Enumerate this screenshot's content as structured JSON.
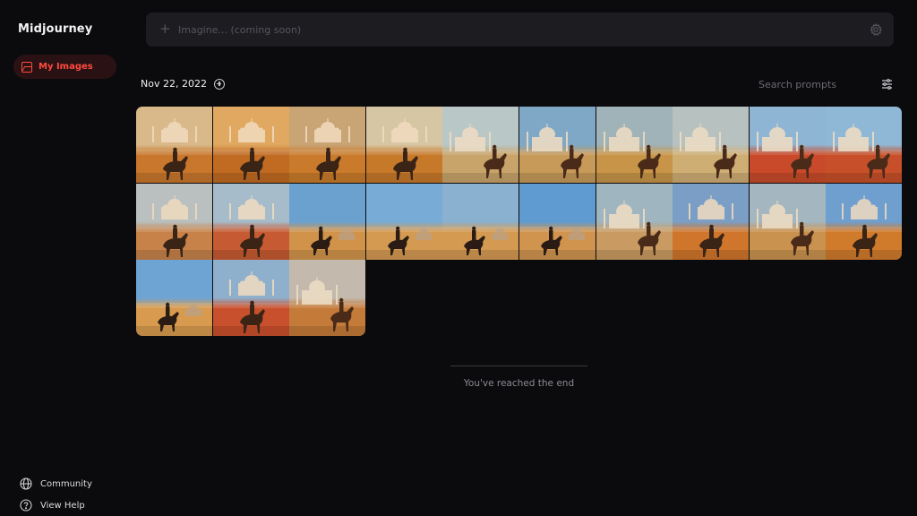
{
  "app": {
    "brand": "Midjourney"
  },
  "sidebar": {
    "active_item": {
      "label": "My Images",
      "icon": "image-icon",
      "accent": "#ff4a3d"
    },
    "bottom_links": [
      {
        "label": "Community",
        "icon": "globe-icon"
      },
      {
        "label": "View Help",
        "icon": "help-circle-icon"
      }
    ]
  },
  "prompt": {
    "placeholder": "Imagine... (coming soon)",
    "value": ""
  },
  "gallery": {
    "date": "Nov 22, 2022",
    "search_placeholder": "Search prompts",
    "end_text": "You've reached the end",
    "tiles": [
      {
        "sky": "#d9b98a",
        "ground": "#c9772c",
        "variant": "a"
      },
      {
        "sky": "#e0a860",
        "ground": "#c06a22",
        "variant": "a"
      },
      {
        "sky": "#c9a474",
        "ground": "#c97a2a",
        "variant": "a"
      },
      {
        "sky": "#d7c6a4",
        "ground": "#c7792a",
        "variant": "a"
      },
      {
        "sky": "#b9c7c7",
        "ground": "#c8a46a",
        "variant": "b"
      },
      {
        "sky": "#7ea8c6",
        "ground": "#c79a5a",
        "variant": "b"
      },
      {
        "sky": "#9fb3b8",
        "ground": "#c79448",
        "variant": "b"
      },
      {
        "sky": "#b7c2c0",
        "ground": "#cfae74",
        "variant": "b"
      },
      {
        "sky": "#8fb5d4",
        "ground": "#c84a2a",
        "variant": "b"
      },
      {
        "sky": "#8fb8d6",
        "ground": "#c7502a",
        "variant": "b"
      },
      {
        "sky": "#b9c0bf",
        "ground": "#c7824a",
        "variant": "a"
      },
      {
        "sky": "#a6bccb",
        "ground": "#c65a32",
        "variant": "a"
      },
      {
        "sky": "#6aa1cf",
        "ground": "#d1934a",
        "variant": "c"
      },
      {
        "sky": "#78acd6",
        "ground": "#d49a52",
        "variant": "c"
      },
      {
        "sky": "#8ab1cf",
        "ground": "#d59a52",
        "variant": "c"
      },
      {
        "sky": "#5f9bd0",
        "ground": "#d0944f",
        "variant": "c"
      },
      {
        "sky": "#9fb5bf",
        "ground": "#c99b62",
        "variant": "b"
      },
      {
        "sky": "#7a9ec6",
        "ground": "#d0762c",
        "variant": "a"
      },
      {
        "sky": "#a4b6bf",
        "ground": "#c9924e",
        "variant": "b"
      },
      {
        "sky": "#6f9fcf",
        "ground": "#d07a2c",
        "variant": "a"
      },
      {
        "sky": "#6ea4d4",
        "ground": "#d89a4e",
        "variant": "c"
      },
      {
        "sky": "#8fb0cd",
        "ground": "#c9502c",
        "variant": "a"
      },
      {
        "sky": "#c3b9ad",
        "ground": "#c47a38",
        "variant": "b"
      }
    ]
  }
}
